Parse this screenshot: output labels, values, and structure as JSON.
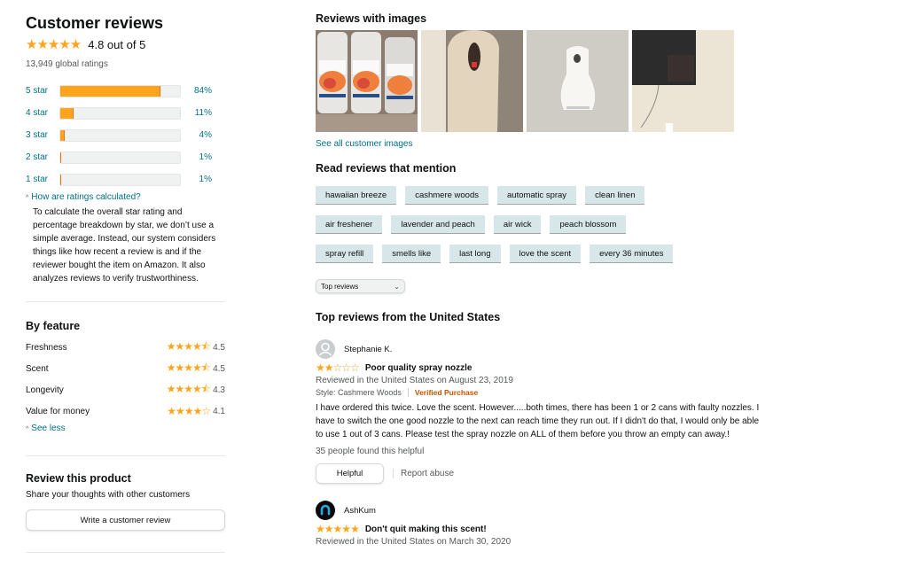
{
  "summary": {
    "title": "Customer reviews",
    "overall_stars": "★★★★★",
    "rating": 4.8,
    "rating_text": "4.8 out of 5",
    "global_ratings": "13,949 global ratings",
    "histogram": [
      {
        "label": "5 star",
        "percent": 84,
        "percent_text": "84%"
      },
      {
        "label": "4 star",
        "percent": 11,
        "percent_text": "11%"
      },
      {
        "label": "3 star",
        "percent": 4,
        "percent_text": "4%"
      },
      {
        "label": "2 star",
        "percent": 1,
        "percent_text": "1%"
      },
      {
        "label": "1 star",
        "percent": 1,
        "percent_text": "1%"
      }
    ],
    "how_calculated_link": "How are ratings calculated?",
    "how_calculated_text": "To calculate the overall star rating and percentage breakdown by star, we don’t use a simple average. Instead, our system considers things like how recent a review is and if the reviewer bought the item on Amazon. It also analyzes reviews to verify trustworthiness."
  },
  "by_feature": {
    "title": "By feature",
    "items": [
      {
        "name": "Freshness",
        "rating": "4.5",
        "stars": "★★★★⯪"
      },
      {
        "name": "Scent",
        "rating": "4.5",
        "stars": "★★★★⯪"
      },
      {
        "name": "Longevity",
        "rating": "4.3",
        "stars": "★★★★⯪"
      },
      {
        "name": "Value for money",
        "rating": "4.1",
        "stars": "★★★★☆"
      }
    ],
    "see_less": "See less"
  },
  "review_product": {
    "title": "Review this product",
    "subtitle": "Share your thoughts with other customers",
    "button": "Write a customer review"
  },
  "images_section": {
    "title": "Reviews with images",
    "images": [
      "glade-refill-cans-photo",
      "dispenser-closeup-photo",
      "dispenser-on-wall-photo",
      "tv-wall-photo"
    ],
    "see_all": "See all customer images"
  },
  "mentions": {
    "title": "Read reviews that mention",
    "rows": [
      [
        "hawaiian breeze",
        "cashmere woods",
        "automatic spray",
        "clean linen"
      ],
      [
        "air freshener",
        "lavender and peach",
        "air wick",
        "peach blossom"
      ],
      [
        "spray refill",
        "smells like",
        "last long",
        "love the scent",
        "every 36 minutes"
      ]
    ]
  },
  "sort": {
    "selected": "Top reviews"
  },
  "top_reviews": {
    "title": "Top reviews from the United States",
    "reviews": [
      {
        "author": "Stephanie K.",
        "stars": 2,
        "title": "Poor quality spray nozzle",
        "date": "Reviewed in the United States on August 23, 2019",
        "style": "Style: Cashmere Woods",
        "verified": "Verified Purchase",
        "body": "I have ordered this twice. Love the scent. However.....both times, there has been 1 or 2 cans with faulty nozzles. I have to switch the one good nozzle to the next can reach time they run out. If I didn't do that, I would only be able to use 1 out of 3 cans. Please test the spray nozzle on ALL of them before you throw an empty can away.!",
        "helpful_count": "35 people found this helpful",
        "helpful_button": "Helpful",
        "report": "Report abuse"
      },
      {
        "author": "AshKum",
        "stars": 5,
        "title": "Don't quit making this scent!",
        "date": "Reviewed in the United States on March 30, 2020"
      }
    ]
  },
  "colors": {
    "star": "#ffa41c",
    "link": "#007185",
    "verified": "#c45500",
    "tag_bg": "#d6e6e9"
  }
}
